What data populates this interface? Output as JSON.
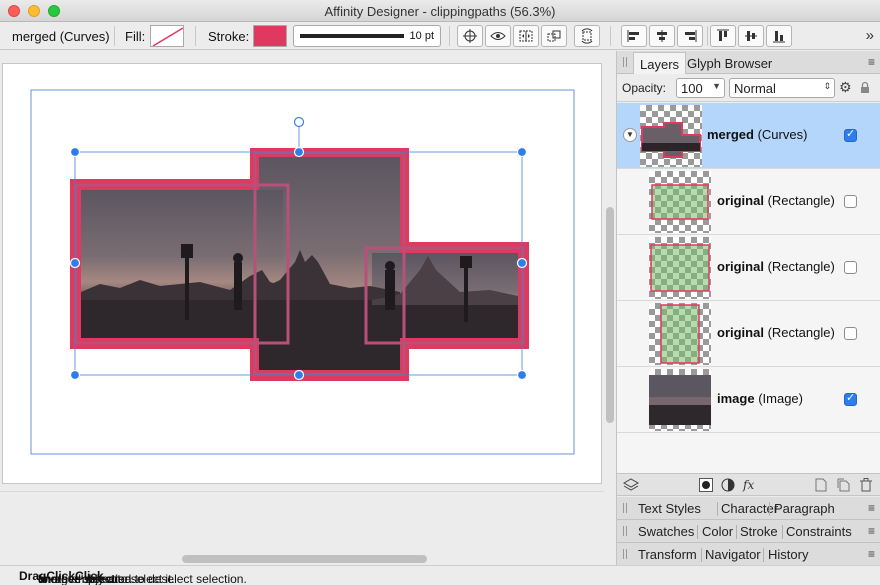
{
  "window": {
    "title": "Affinity Designer - clippingpaths (56.3%)"
  },
  "context_toolbar": {
    "selection_label": "merged (Curves)",
    "fill_label": "Fill:",
    "stroke_label": "Stroke:",
    "stroke_width": "10 pt",
    "stroke_color": "#e0395f",
    "more_icon": "»"
  },
  "panel": {
    "tabs": [
      {
        "label": "Layers"
      },
      {
        "label": "Glyph Browser"
      }
    ],
    "opacity_label": "Opacity:",
    "opacity_value": "100",
    "blend_mode": "Normal",
    "layers": [
      {
        "name": "merged",
        "type": "(Curves)",
        "visible": true
      },
      {
        "name": "original",
        "type": "(Rectangle)",
        "visible": false
      },
      {
        "name": "original",
        "type": "(Rectangle)",
        "visible": false
      },
      {
        "name": "original",
        "type": "(Rectangle)",
        "visible": false
      },
      {
        "name": "image",
        "type": "(Image)",
        "visible": true
      }
    ],
    "subpanels": [
      {
        "items": [
          "Text Styles",
          "Character",
          "Paragraph"
        ]
      },
      {
        "items": [
          "Swatches",
          "Color",
          "Stroke",
          "Constraints"
        ]
      },
      {
        "items": [
          "Transform",
          "Navigator",
          "History"
        ]
      }
    ]
  },
  "status": {
    "parts": [
      {
        "text": "'merged' selected. ",
        "bold": false
      },
      {
        "text": "Drag",
        "bold": true
      },
      {
        "text": " to move selection. ",
        "bold": false
      },
      {
        "text": "Click",
        "bold": true
      },
      {
        "text": " another object to select it. ",
        "bold": false
      },
      {
        "text": "Click",
        "bold": true
      },
      {
        "text": " on an empty area to deselect selection.",
        "bold": false
      }
    ]
  },
  "colors": {
    "accent": "#2f7dec",
    "stroke": "#e0395f",
    "selection_row": "#b4d6fb"
  }
}
